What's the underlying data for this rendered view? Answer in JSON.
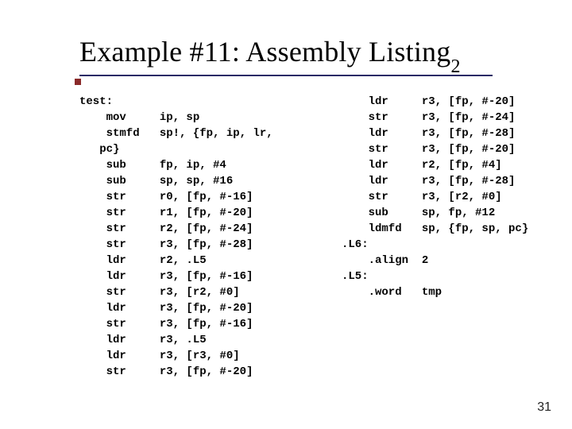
{
  "title": {
    "main": "Example #11: Assembly Listing",
    "subscript": "2"
  },
  "pagenum": "31",
  "code": {
    "left": "test:\n    mov     ip, sp\n    stmfd   sp!, {fp, ip, lr,\n   pc}\n    sub     fp, ip, #4\n    sub     sp, sp, #16\n    str     r0, [fp, #-16]\n    str     r1, [fp, #-20]\n    str     r2, [fp, #-24]\n    str     r3, [fp, #-28]\n    ldr     r2, .L5\n    ldr     r3, [fp, #-16]\n    str     r3, [r2, #0]\n    ldr     r3, [fp, #-20]\n    str     r3, [fp, #-16]\n    ldr     r3, .L5\n    ldr     r3, [r3, #0]\n    str     r3, [fp, #-20]",
    "right": "    ldr     r3, [fp, #-20]\n    str     r3, [fp, #-24]\n    ldr     r3, [fp, #-28]\n    str     r3, [fp, #-20]\n    ldr     r2, [fp, #4]\n    ldr     r3, [fp, #-28]\n    str     r3, [r2, #0]\n    sub     sp, fp, #12\n    ldmfd   sp, {fp, sp, pc}\n.L6:\n    .align  2\n.L5:\n    .word   tmp"
  }
}
